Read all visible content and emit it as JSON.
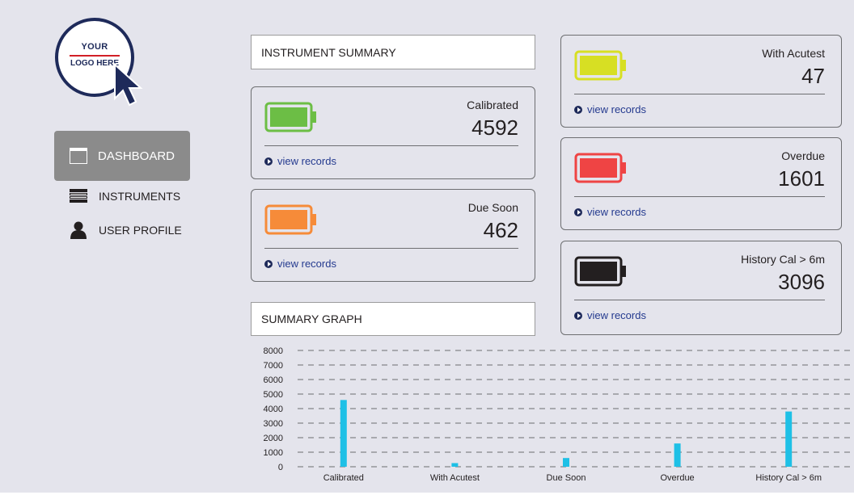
{
  "logo": {
    "line1": "YOUR",
    "line2": "LOGO HERE"
  },
  "nav": {
    "dashboard": "DASHBOARD",
    "instruments": "INSTRUMENTS",
    "profile": "USER PROFILE"
  },
  "instrument_summary_title": "INSTRUMENT SUMMARY",
  "summary_graph_title": "SUMMARY GRAPH",
  "cards": {
    "calibrated": {
      "label": "Calibrated",
      "value": "4592",
      "link": "view records",
      "color": "#6cbe45"
    },
    "due_soon": {
      "label": "Due Soon",
      "value": "462",
      "link": "view records",
      "color": "#f68b39"
    },
    "with_acutest": {
      "label": "With Acutest",
      "value": "47",
      "link": "view records",
      "color": "#d7df23"
    },
    "overdue": {
      "label": "Overdue",
      "value": "1601",
      "link": "view records",
      "color": "#ef4444"
    },
    "history": {
      "label": "History Cal > 6m",
      "value": "3096",
      "link": "view records",
      "color": "#231f20"
    }
  },
  "chart_data": {
    "type": "bar",
    "categories": [
      "Calibrated",
      "With Acutest",
      "Due Soon",
      "Overdue",
      "History Cal > 6m"
    ],
    "values": [
      4592,
      250,
      600,
      1601,
      3800
    ],
    "y_ticks": [
      "0",
      "1000",
      "2000",
      "3000",
      "4000",
      "5000",
      "6000",
      "7000",
      "8000"
    ],
    "ylim": [
      0,
      8000
    ],
    "grid": true,
    "bar_color": "#1ec0e6"
  }
}
